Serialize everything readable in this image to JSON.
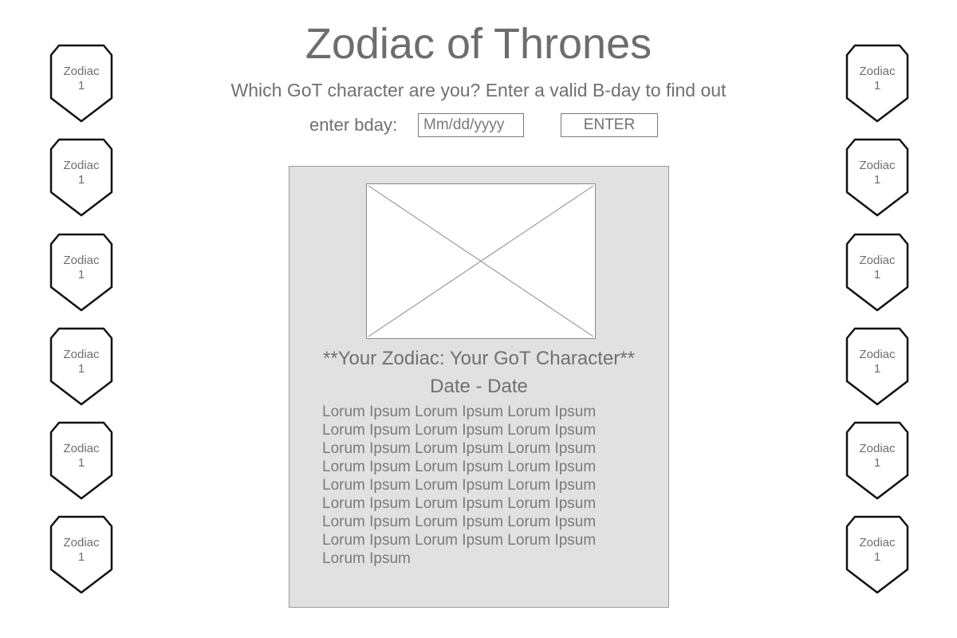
{
  "header": {
    "title": "Zodiac of Thrones",
    "subtitle": "Which GoT character are you? Enter a valid B-day to find out"
  },
  "bday_form": {
    "label": "enter bday:",
    "input_placeholder": "Mm/dd/yyyy",
    "input_value": "",
    "enter_button_label": "ENTER"
  },
  "zodiac_left": [
    {
      "label_line1": "Zodiac",
      "label_line2": "1"
    },
    {
      "label_line1": "Zodiac",
      "label_line2": "1"
    },
    {
      "label_line1": "Zodiac",
      "label_line2": "1"
    },
    {
      "label_line1": "Zodiac",
      "label_line2": "1"
    },
    {
      "label_line1": "Zodiac",
      "label_line2": "1"
    },
    {
      "label_line1": "Zodiac",
      "label_line2": "1"
    }
  ],
  "zodiac_right": [
    {
      "label_line1": "Zodiac",
      "label_line2": "1"
    },
    {
      "label_line1": "Zodiac",
      "label_line2": "1"
    },
    {
      "label_line1": "Zodiac",
      "label_line2": "1"
    },
    {
      "label_line1": "Zodiac",
      "label_line2": "1"
    },
    {
      "label_line1": "Zodiac",
      "label_line2": "1"
    },
    {
      "label_line1": "Zodiac",
      "label_line2": "1"
    }
  ],
  "result": {
    "title": "**Your Zodiac: Your GoT Character**",
    "dates": "Date - Date",
    "body_lines": [
      "Lorum Ipsum Lorum Ipsum Lorum Ipsum",
      "Lorum Ipsum Lorum Ipsum Lorum Ipsum",
      "Lorum Ipsum Lorum Ipsum Lorum Ipsum",
      "Lorum Ipsum Lorum Ipsum Lorum Ipsum",
      "Lorum Ipsum Lorum Ipsum Lorum Ipsum",
      "Lorum Ipsum Lorum Ipsum Lorum Ipsum",
      "Lorum Ipsum Lorum Ipsum Lorum Ipsum",
      "Lorum Ipsum Lorum Ipsum Lorum Ipsum",
      "Lorum Ipsum"
    ]
  }
}
